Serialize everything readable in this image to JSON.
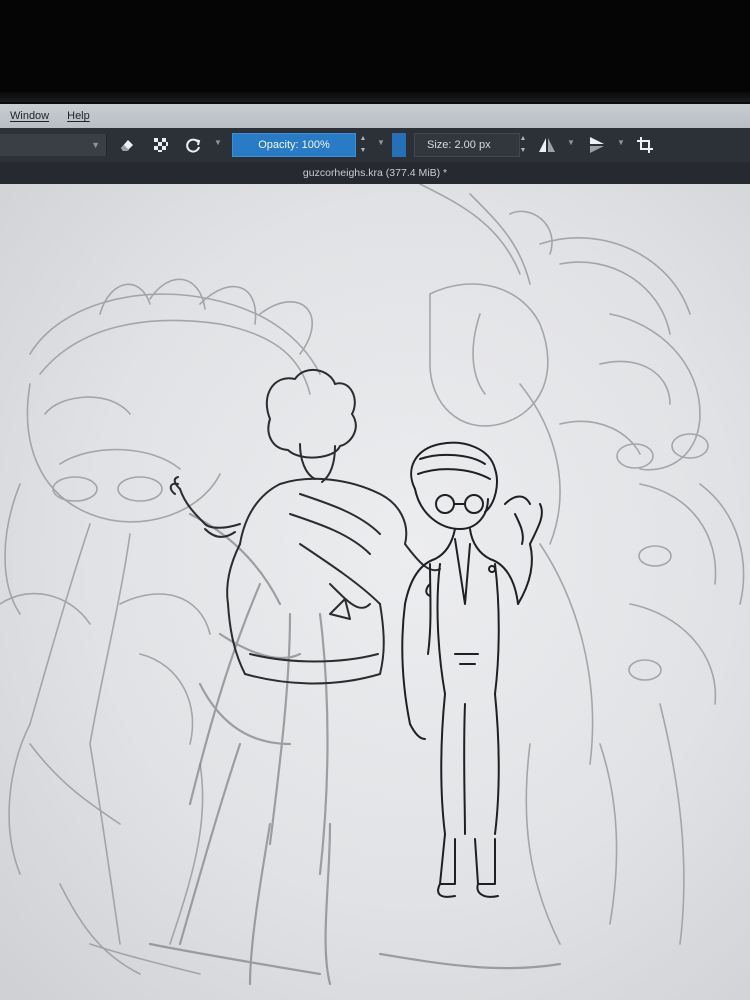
{
  "menubar": {
    "items": [
      "Window",
      "Help"
    ]
  },
  "toolbar": {
    "opacity_label": "Opacity: 100%",
    "size_label": "Size: 2.00 px",
    "icons": [
      "eraser-icon",
      "alpha-lock-icon",
      "reset-icon",
      "mirror-horizontal-icon",
      "mirror-vertical-icon",
      "wrap-around-icon"
    ]
  },
  "document": {
    "title": "guzcorheighs.kra (377.4 MiB) *"
  },
  "colors": {
    "accent": "#2a7bc6",
    "toolbar_bg": "#2c3037",
    "canvas_bg": "#e6e7e9"
  }
}
